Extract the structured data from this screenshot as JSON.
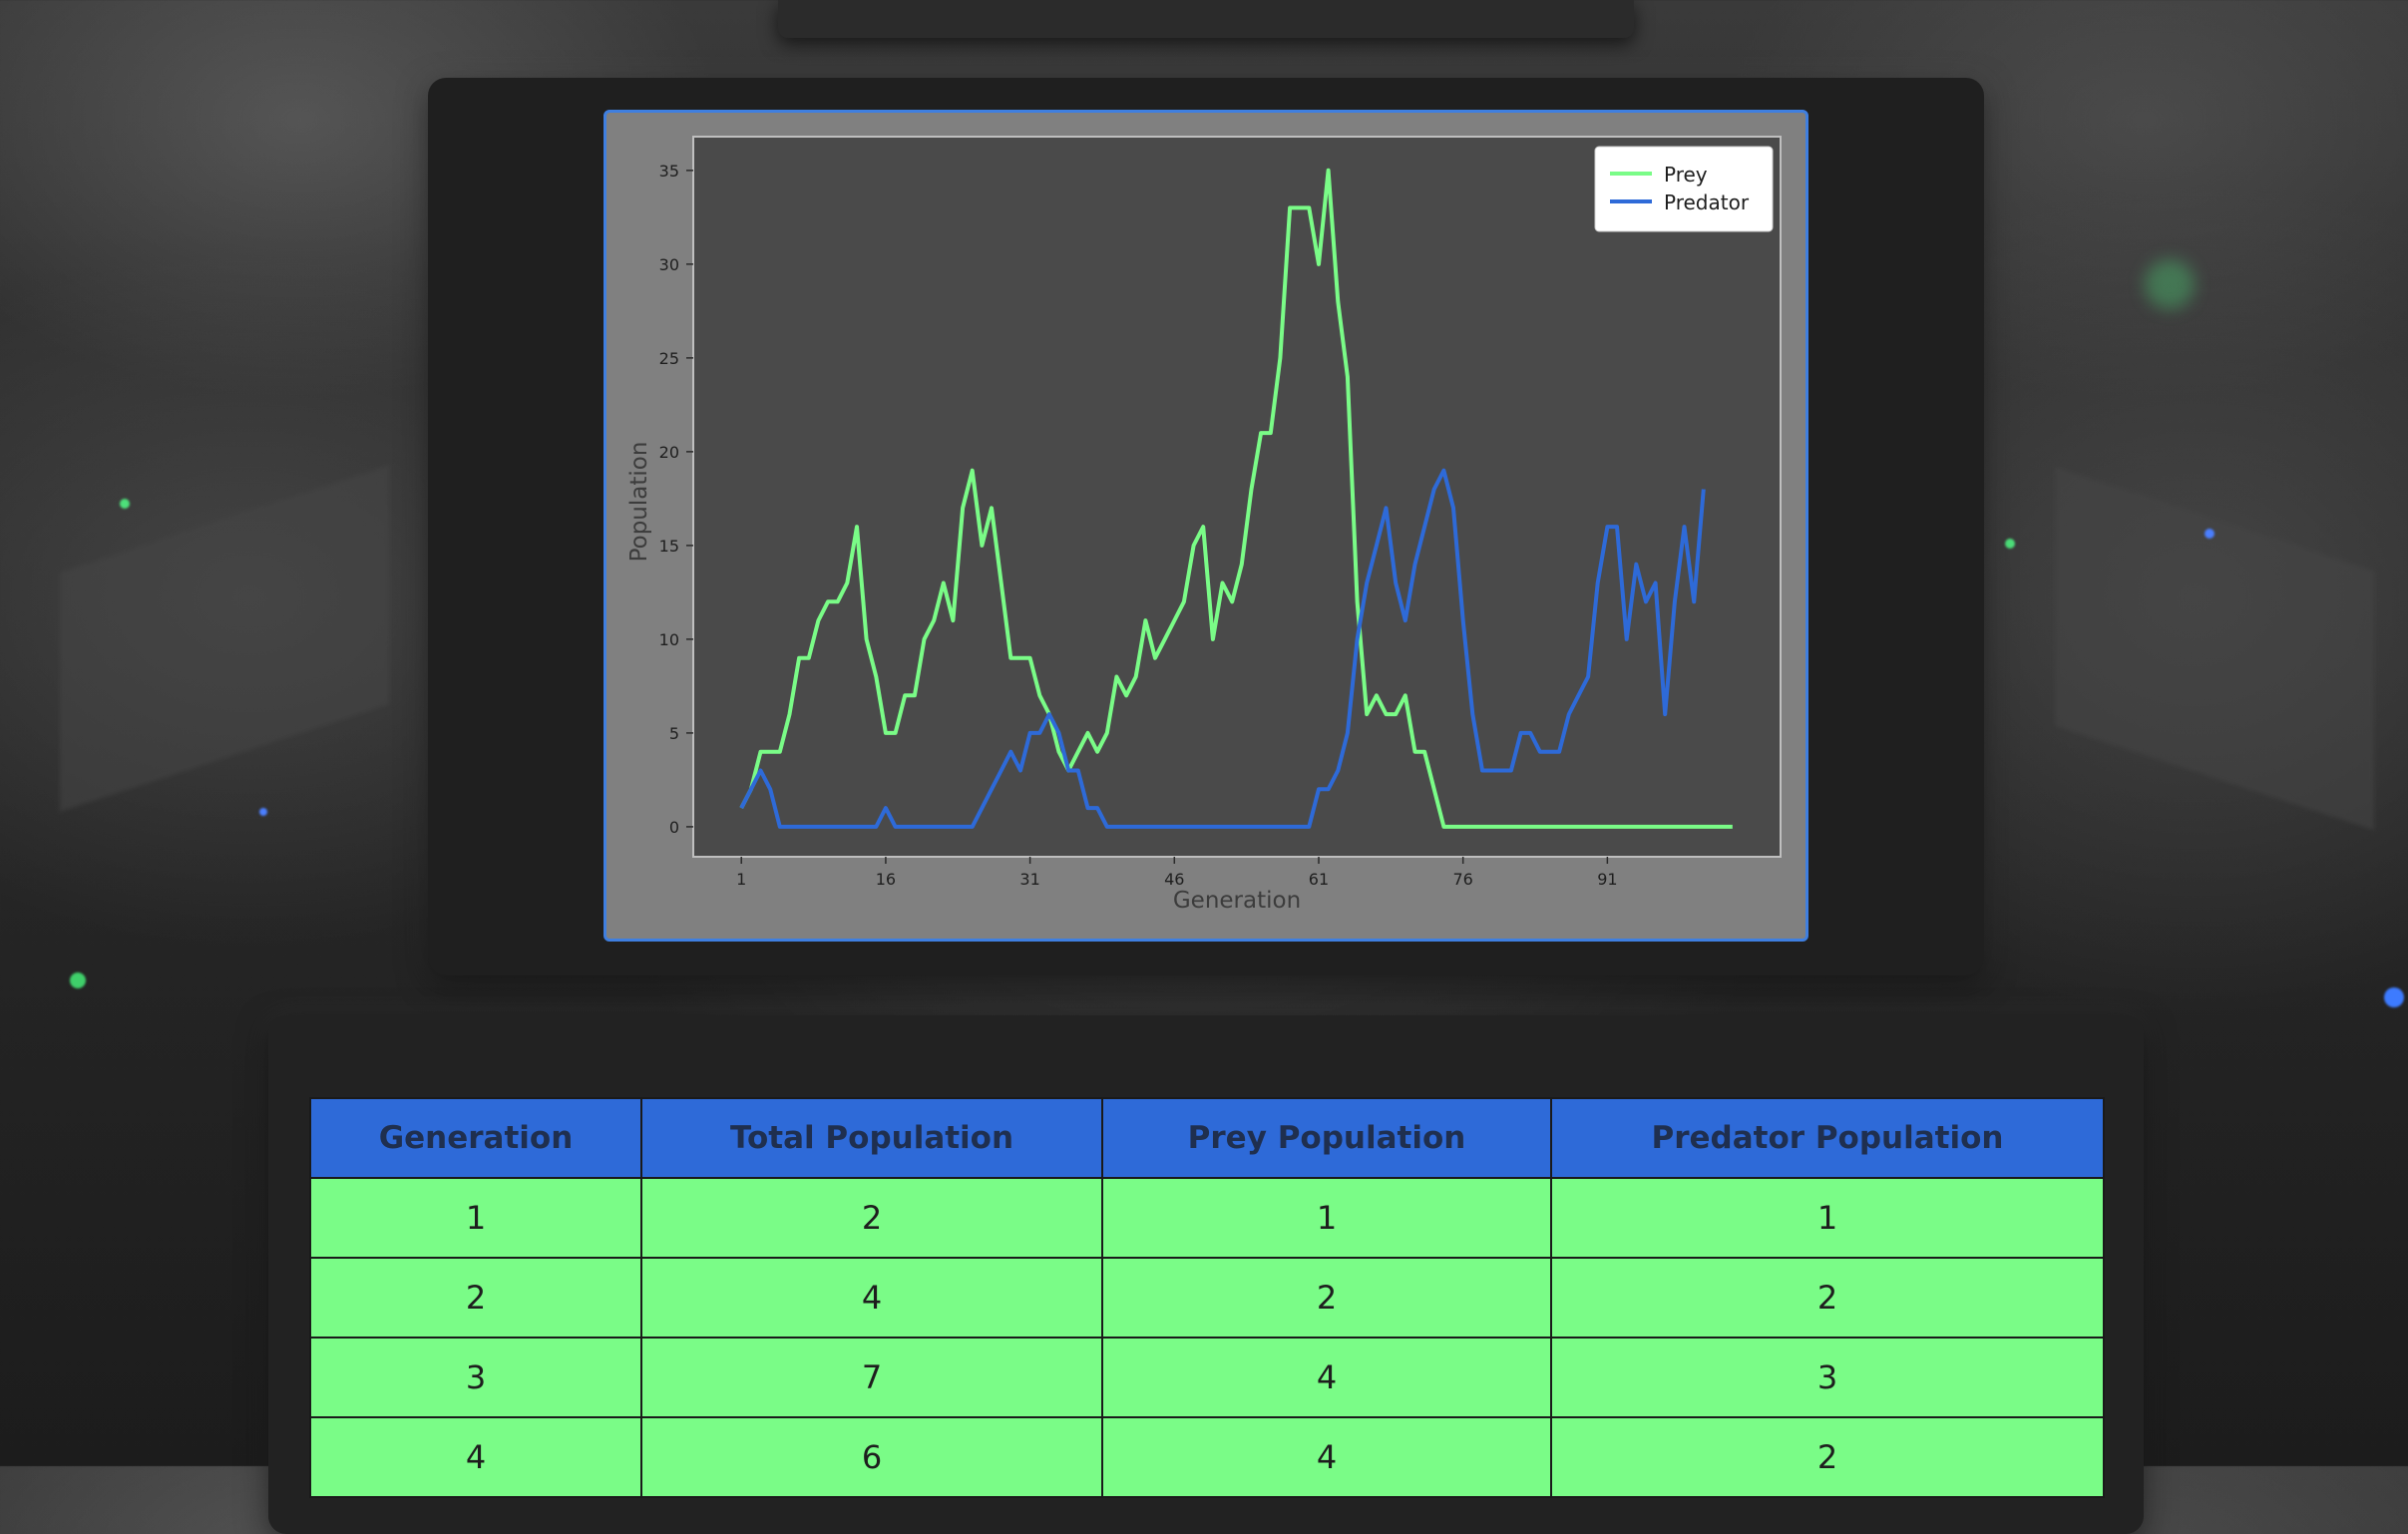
{
  "chart_data": {
    "type": "line",
    "xlabel": "Generation",
    "ylabel": "Population",
    "x_ticks": [
      1,
      16,
      31,
      46,
      61,
      76,
      91
    ],
    "y_ticks": [
      0,
      5,
      10,
      15,
      20,
      25,
      30,
      35
    ],
    "xlim": [
      -4,
      109
    ],
    "ylim": [
      -1.6,
      36.8
    ],
    "legend_position": "top-right",
    "x_start": 1,
    "series": [
      {
        "name": "Prey",
        "color": "#7afc87",
        "values": [
          1,
          2,
          4,
          4,
          4,
          6,
          9,
          9,
          11,
          12,
          12,
          13,
          16,
          10,
          8,
          5,
          5,
          7,
          7,
          10,
          11,
          13,
          11,
          17,
          19,
          15,
          17,
          13,
          9,
          9,
          9,
          7,
          6,
          4,
          3,
          4,
          5,
          4,
          5,
          8,
          7,
          8,
          11,
          9,
          10,
          11,
          12,
          15,
          16,
          10,
          13,
          12,
          14,
          18,
          21,
          21,
          25,
          33,
          33,
          33,
          30,
          35,
          28,
          24,
          12,
          6,
          7,
          6,
          6,
          7,
          4,
          4,
          2,
          0,
          0,
          0,
          0,
          0,
          0,
          0,
          0,
          0,
          0,
          0,
          0,
          0,
          0,
          0,
          0,
          0,
          0,
          0,
          0,
          0,
          0,
          0,
          0,
          0,
          0,
          0,
          0,
          0,
          0,
          0
        ]
      },
      {
        "name": "Predator",
        "color": "#2e6ad8",
        "values": [
          1,
          2,
          3,
          2,
          0,
          0,
          0,
          0,
          0,
          0,
          0,
          0,
          0,
          0,
          0,
          1,
          0,
          0,
          0,
          0,
          0,
          0,
          0,
          0,
          0,
          1,
          2,
          3,
          4,
          3,
          5,
          5,
          6,
          5,
          3,
          3,
          1,
          1,
          0,
          0,
          0,
          0,
          0,
          0,
          0,
          0,
          0,
          0,
          0,
          0,
          0,
          0,
          0,
          0,
          0,
          0,
          0,
          0,
          0,
          0,
          2,
          2,
          3,
          5,
          10,
          13,
          15,
          17,
          13,
          11,
          14,
          16,
          18,
          19,
          17,
          11,
          6,
          3,
          3,
          3,
          3,
          5,
          5,
          4,
          4,
          4,
          6,
          7,
          8,
          13,
          16,
          16,
          10,
          14,
          12,
          13,
          6,
          12,
          16,
          12,
          18
        ]
      }
    ]
  },
  "table": {
    "headers": [
      "Generation",
      "Total Population",
      "Prey Population",
      "Predator Population"
    ],
    "rows": [
      [
        "1",
        "2",
        "1",
        "1"
      ],
      [
        "2",
        "4",
        "2",
        "2"
      ],
      [
        "3",
        "7",
        "4",
        "3"
      ],
      [
        "4",
        "6",
        "4",
        "2"
      ]
    ]
  }
}
